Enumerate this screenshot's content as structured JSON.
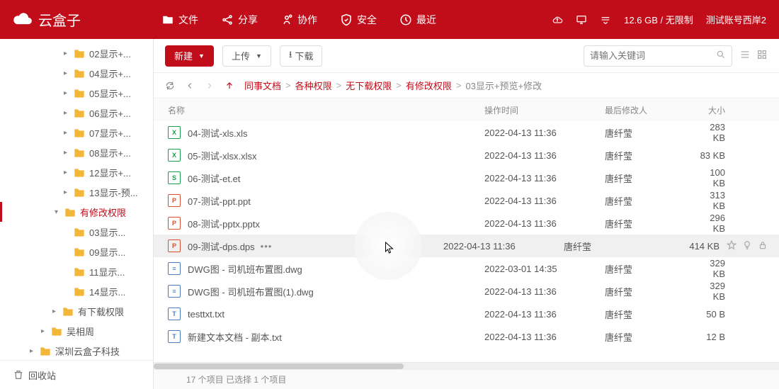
{
  "app": {
    "name": "云盒子"
  },
  "nav": {
    "file": "文件",
    "share": "分享",
    "collab": "协作",
    "security": "安全",
    "recent": "最近"
  },
  "header_right": {
    "storage": "12.6 GB / 无限制",
    "account": "测试账号西岸2"
  },
  "toolbar": {
    "new": "新建",
    "upload": "上传",
    "download": "下载",
    "search_placeholder": "请输入关键词"
  },
  "breadcrumb": {
    "items": [
      "同事文档",
      "各种权限",
      "无下载权限",
      "有修改权限"
    ],
    "current": "03显示+预览+修改"
  },
  "columns": {
    "name": "名称",
    "time": "操作时间",
    "modifier": "最后修改人",
    "size": "大小"
  },
  "tree": [
    {
      "indent": 5,
      "arrow": "▸",
      "label": "02显示+...",
      "selected": false
    },
    {
      "indent": 5,
      "arrow": "▸",
      "label": "04显示+...",
      "selected": false
    },
    {
      "indent": 5,
      "arrow": "▸",
      "label": "05显示+...",
      "selected": false
    },
    {
      "indent": 5,
      "arrow": "▸",
      "label": "06显示+...",
      "selected": false
    },
    {
      "indent": 5,
      "arrow": "▸",
      "label": "07显示+...",
      "selected": false
    },
    {
      "indent": 5,
      "arrow": "▸",
      "label": "08显示+...",
      "selected": false
    },
    {
      "indent": 5,
      "arrow": "▸",
      "label": "12显示+...",
      "selected": false
    },
    {
      "indent": 5,
      "arrow": "▸",
      "label": "13显示-预...",
      "selected": false
    },
    {
      "indent": 4,
      "arrow": "▾",
      "label": "有修改权限",
      "selected": true
    },
    {
      "indent": 5,
      "arrow": "",
      "label": "03显示...",
      "selected": false
    },
    {
      "indent": 5,
      "arrow": "",
      "label": "09显示...",
      "selected": false
    },
    {
      "indent": 5,
      "arrow": "",
      "label": "11显示...",
      "selected": false
    },
    {
      "indent": 5,
      "arrow": "",
      "label": "14显示...",
      "selected": false
    },
    {
      "indent": 4,
      "arrow": "▸",
      "label": "有下载权限",
      "selected": false
    },
    {
      "indent": 3,
      "arrow": "▸",
      "label": "吴相周",
      "selected": false
    },
    {
      "indent": 2,
      "arrow": "▸",
      "label": "深圳云盒子科技",
      "selected": false
    }
  ],
  "sidebar_bottom": {
    "recycle": "回收站"
  },
  "files": [
    {
      "icon": "xls",
      "letter": "X",
      "name": "04-测试-xls.xls",
      "time": "2022-04-13 11:36",
      "modifier": "唐纤莹",
      "size": "283 KB",
      "active": false
    },
    {
      "icon": "xls",
      "letter": "X",
      "name": "05-测试-xlsx.xlsx",
      "time": "2022-04-13 11:36",
      "modifier": "唐纤莹",
      "size": "83 KB",
      "active": false
    },
    {
      "icon": "et",
      "letter": "S",
      "name": "06-测试-et.et",
      "time": "2022-04-13 11:36",
      "modifier": "唐纤莹",
      "size": "100 KB",
      "active": false
    },
    {
      "icon": "ppt",
      "letter": "P",
      "name": "07-测试-ppt.ppt",
      "time": "2022-04-13 11:36",
      "modifier": "唐纤莹",
      "size": "313 KB",
      "active": false
    },
    {
      "icon": "ppt",
      "letter": "P",
      "name": "08-测试-pptx.pptx",
      "time": "2022-04-13 11:36",
      "modifier": "唐纤莹",
      "size": "296 KB",
      "active": false
    },
    {
      "icon": "ppt",
      "letter": "P",
      "name": "09-测试-dps.dps",
      "time": "2022-04-13 11:36",
      "modifier": "唐纤莹",
      "size": "414 KB",
      "active": true
    },
    {
      "icon": "dwg",
      "letter": "≡",
      "name": "DWG图 - 司机班布置图.dwg",
      "time": "2022-03-01 14:35",
      "modifier": "唐纤莹",
      "size": "329 KB",
      "active": false
    },
    {
      "icon": "dwg",
      "letter": "≡",
      "name": "DWG图 - 司机班布置图(1).dwg",
      "time": "2022-04-13 11:36",
      "modifier": "唐纤莹",
      "size": "329 KB",
      "active": false
    },
    {
      "icon": "txt",
      "letter": "T",
      "name": "testtxt.txt",
      "time": "2022-04-13 11:36",
      "modifier": "唐纤莹",
      "size": "50 B",
      "active": false
    },
    {
      "icon": "txt",
      "letter": "T",
      "name": "新建文本文档 - 副本.txt",
      "time": "2022-04-13 11:36",
      "modifier": "唐纤莹",
      "size": "12 B",
      "active": false
    }
  ],
  "status": {
    "count_text": "17 个项目",
    "selected_text": "已选择 1 个项目"
  }
}
